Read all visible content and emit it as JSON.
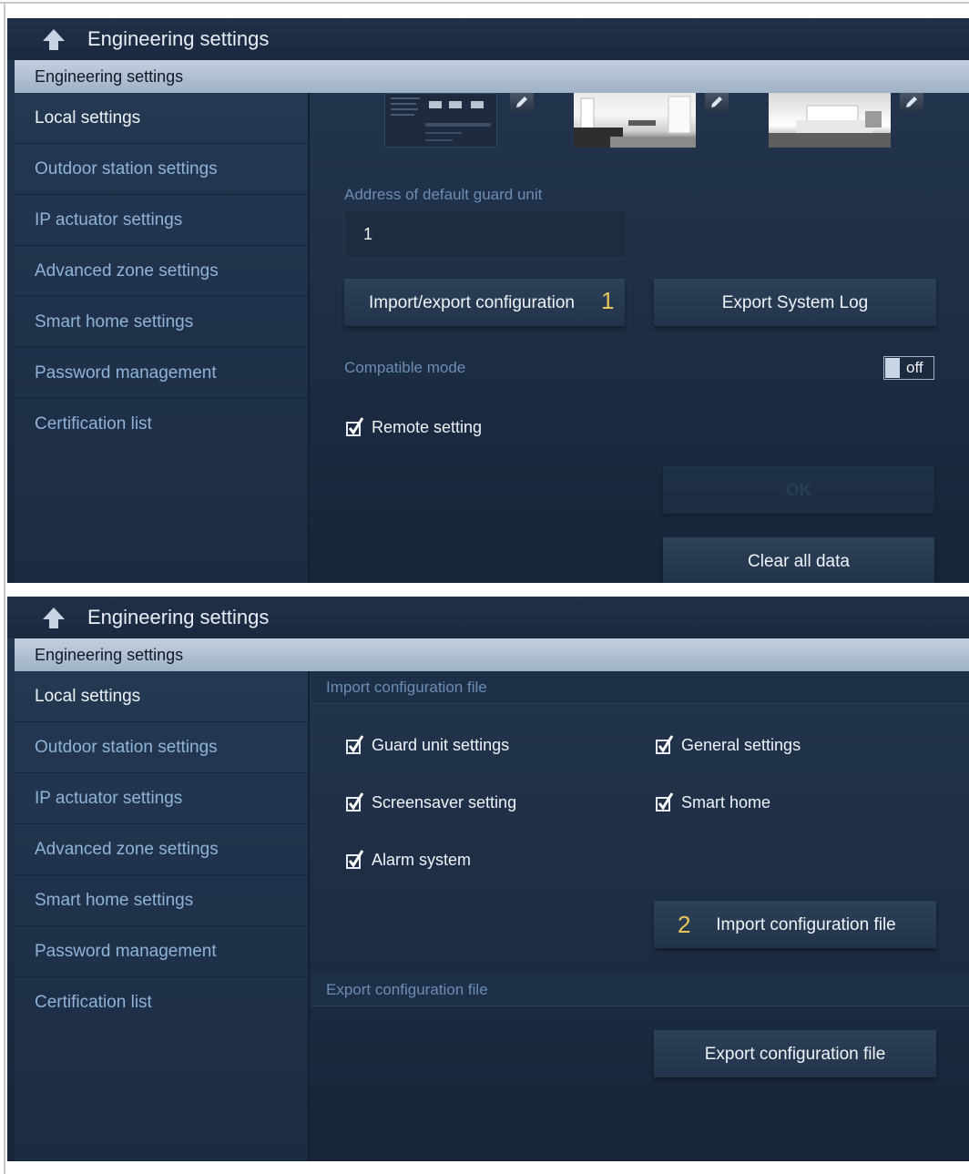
{
  "panel1": {
    "title": "Engineering settings",
    "section": "Engineering settings",
    "sidebar": [
      "Local settings",
      "Outdoor station settings",
      "IP actuator settings",
      "Advanced zone settings",
      "Smart home settings",
      "Password management",
      "Certification list"
    ],
    "guard_label": "Address of default guard unit",
    "guard_value": "1",
    "import_export_button": "Import/export configuration",
    "import_export_badge": "1",
    "export_log_button": "Export System Log",
    "compatible_mode_label": "Compatible mode",
    "compatible_mode_value": "off",
    "remote_setting_label": "Remote setting",
    "remote_setting_checked": true,
    "ok_button": "OK",
    "clear_button": "Clear all data"
  },
  "panel2": {
    "title": "Engineering settings",
    "section": "Engineering settings",
    "sidebar": [
      "Local settings",
      "Outdoor station settings",
      "IP actuator settings",
      "Advanced zone settings",
      "Smart home settings",
      "Password management",
      "Certification list"
    ],
    "import_header": "Import configuration file",
    "options": {
      "guard_unit": "Guard unit settings",
      "general": "General settings",
      "screensaver": "Screensaver setting",
      "smart_home": "Smart home",
      "alarm": "Alarm system"
    },
    "import_badge": "2",
    "import_button": "Import configuration file",
    "export_header": "Export configuration file",
    "export_button": "Export configuration file"
  },
  "colors": {
    "background": "#1d2d44",
    "section_bar": "#b3c3d5",
    "muted_text": "#6c8db3",
    "sidebar_text": "#8fb4d8",
    "badge": "#e6c65a"
  }
}
